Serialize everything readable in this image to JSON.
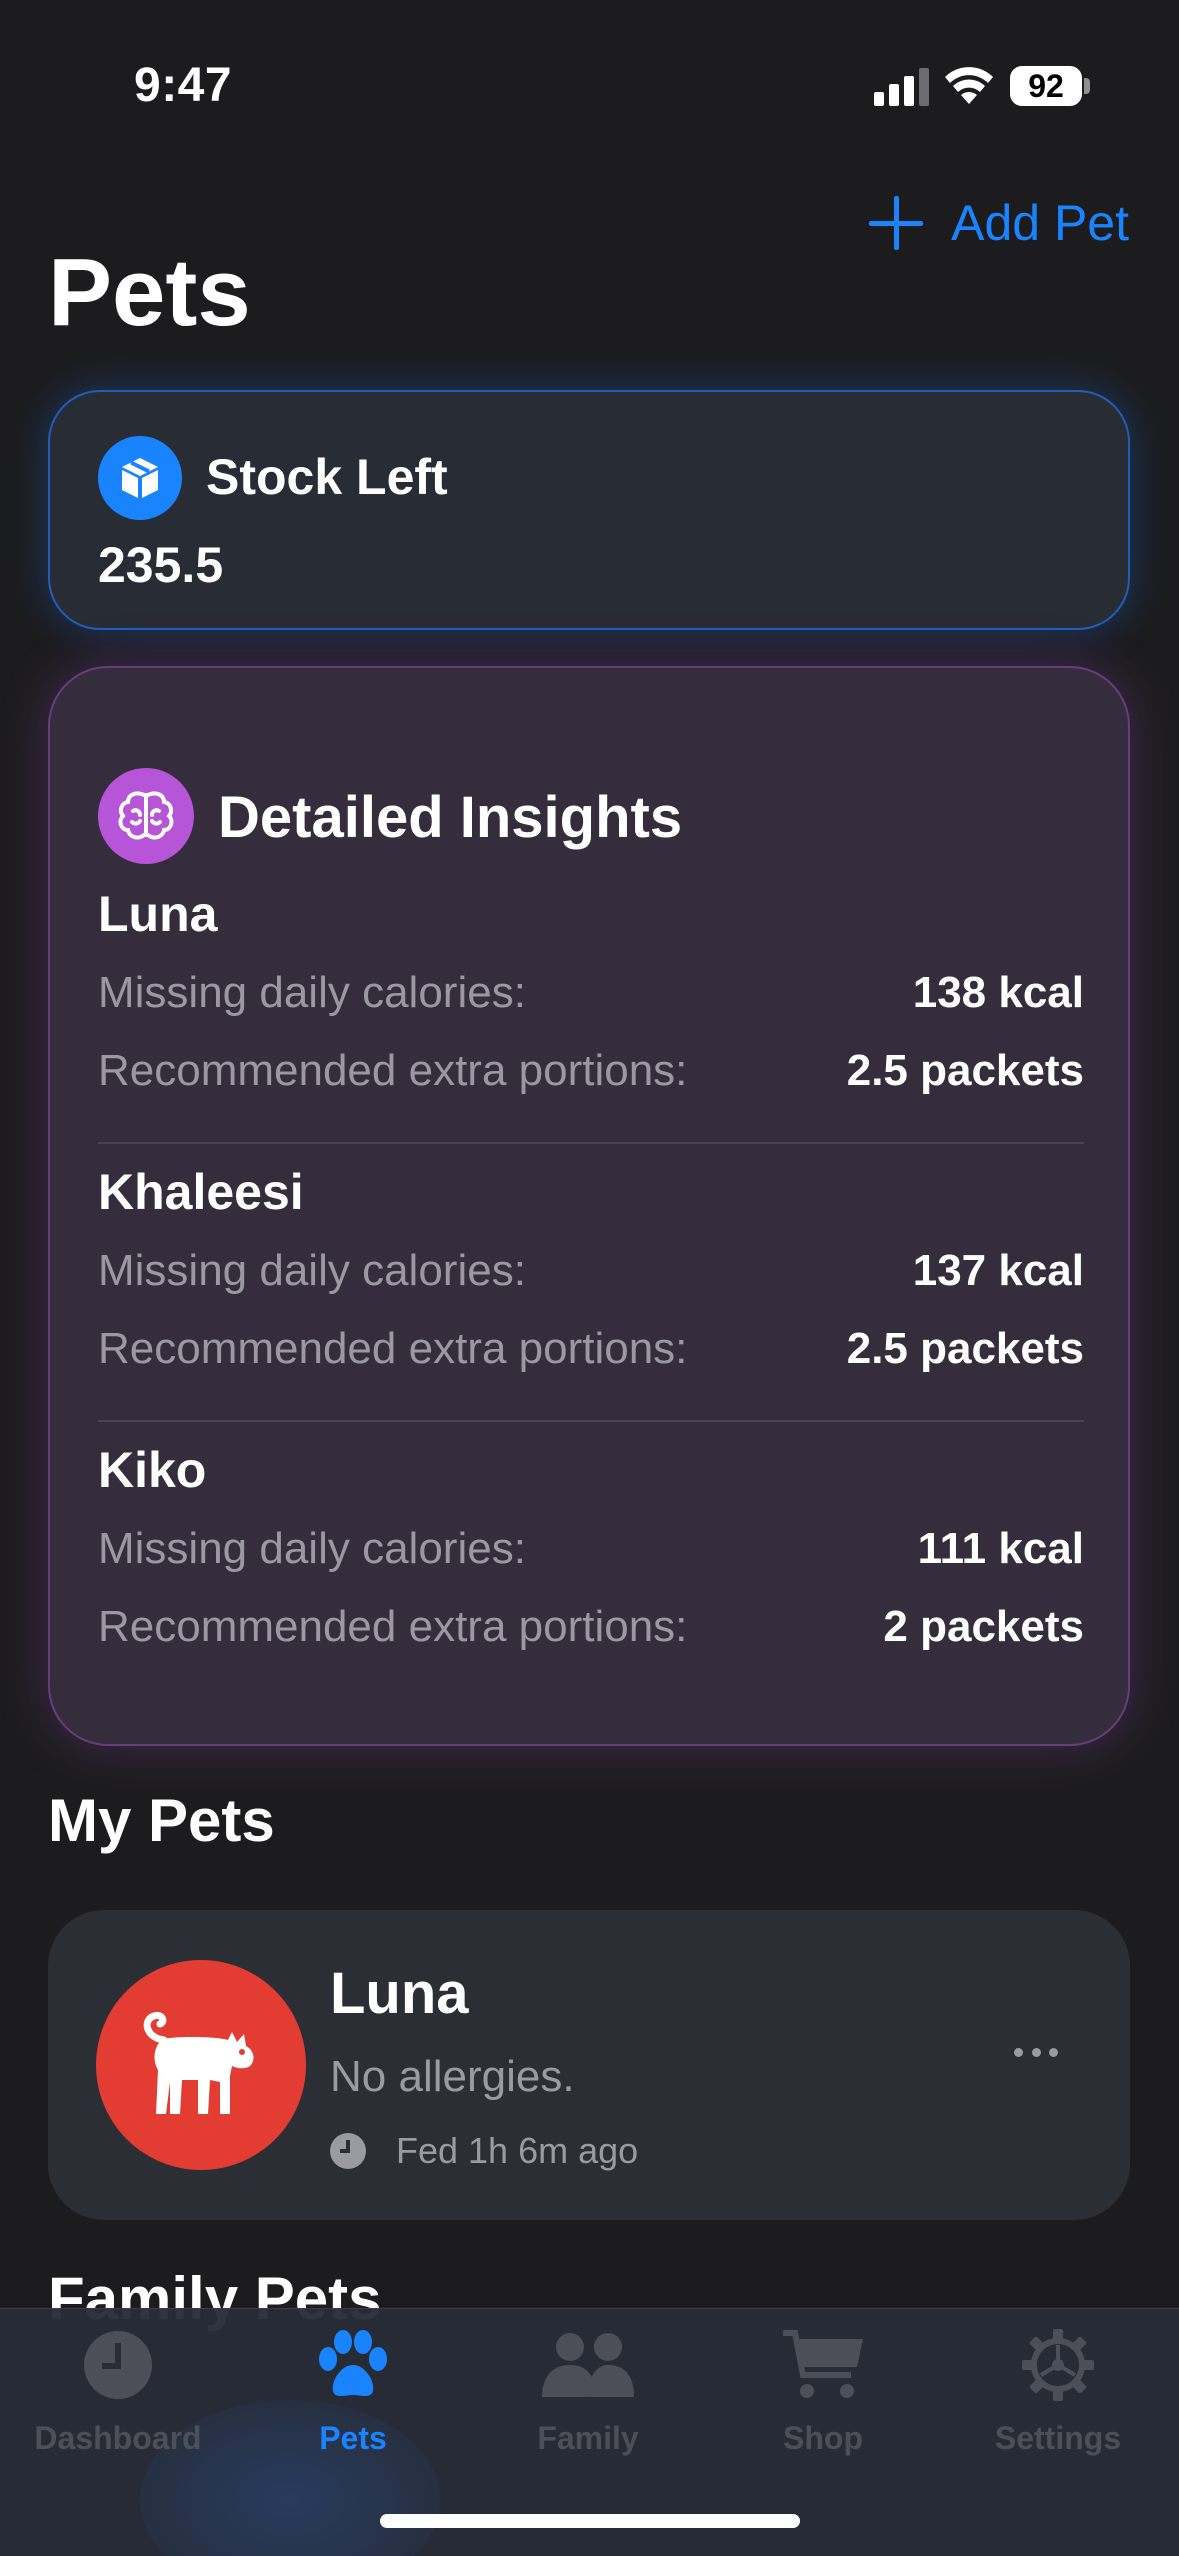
{
  "status_bar": {
    "time": "9:47",
    "battery": "92"
  },
  "header": {
    "add_label": "Add Pet",
    "title": "Pets"
  },
  "stock": {
    "label": "Stock Left",
    "value": "235.5",
    "icon": "box-icon"
  },
  "insights": {
    "title": "Detailed Insights",
    "icon": "brain-icon",
    "pets": [
      {
        "name": "Luna",
        "calories_label": "Missing daily calories:",
        "calories": "138 kcal",
        "portions_label": "Recommended extra portions:",
        "portions": "2.5 packets"
      },
      {
        "name": "Khaleesi",
        "calories_label": "Missing daily calories:",
        "calories": "137 kcal",
        "portions_label": "Recommended extra portions:",
        "portions": "2.5 packets"
      },
      {
        "name": "Kiko",
        "calories_label": "Missing daily calories:",
        "calories": "111 kcal",
        "portions_label": "Recommended extra portions:",
        "portions": "2 packets"
      }
    ]
  },
  "my_pets": {
    "title": "My Pets",
    "pets": [
      {
        "name": "Luna",
        "allergies": "No allergies.",
        "fed": "Fed 1h 6m ago",
        "icon": "cat-icon"
      }
    ]
  },
  "family_pets": {
    "title": "Family Pets"
  },
  "tabs": [
    {
      "label": "Dashboard",
      "icon": "clock-icon"
    },
    {
      "label": "Pets",
      "icon": "paw-icon"
    },
    {
      "label": "Family",
      "icon": "people-icon"
    },
    {
      "label": "Shop",
      "icon": "cart-icon"
    },
    {
      "label": "Settings",
      "icon": "gear-icon"
    }
  ],
  "colors": {
    "accent": "#1a84ff",
    "insights": "#b655d8",
    "avatar": "#e23c33"
  }
}
